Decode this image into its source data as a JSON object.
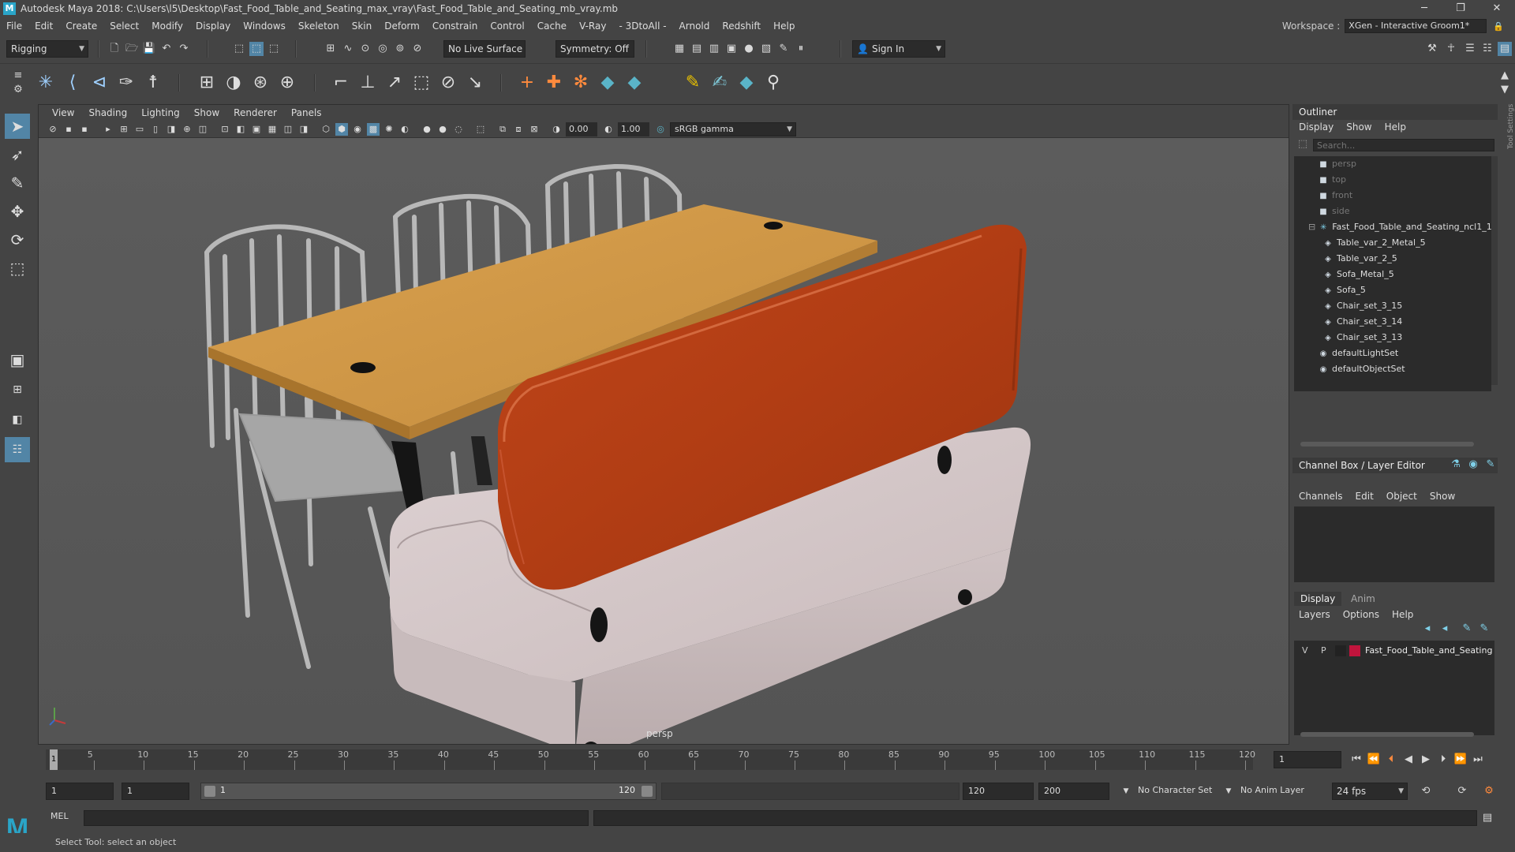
{
  "window": {
    "title": "Autodesk Maya 2018: C:\\Users\\l5\\Desktop\\Fast_Food_Table_and_Seating_max_vray\\Fast_Food_Table_and_Seating_mb_vray.mb",
    "logo": "M",
    "minimize": "─",
    "maximize": "❐",
    "close": "✕"
  },
  "menubar": {
    "items": [
      "File",
      "Edit",
      "Create",
      "Select",
      "Modify",
      "Display",
      "Windows",
      "Skeleton",
      "Skin",
      "Deform",
      "Constrain",
      "Control",
      "Cache",
      "V-Ray",
      "- 3DtoAll -",
      "Arnold",
      "Redshift",
      "Help"
    ],
    "workspace_label": "Workspace :",
    "workspace_value": "XGen - Interactive Groom1*"
  },
  "statusline": {
    "mode": "Rigging",
    "live_surface": "No Live Surface",
    "symmetry": "Symmetry: Off",
    "sign_in": "Sign In"
  },
  "viewport": {
    "menu": [
      "View",
      "Shading",
      "Lighting",
      "Show",
      "Renderer",
      "Panels"
    ],
    "exposure": "0.00",
    "gamma": "1.00",
    "colorspace": "sRGB gamma",
    "camera_label": "persp"
  },
  "outliner": {
    "title": "Outliner",
    "menu": [
      "Display",
      "Show",
      "Help"
    ],
    "search_placeholder": "Search...",
    "items": [
      {
        "label": "persp",
        "dim": true,
        "indent": 1,
        "icon": "camera"
      },
      {
        "label": "top",
        "dim": true,
        "indent": 1,
        "icon": "camera"
      },
      {
        "label": "front",
        "dim": true,
        "indent": 1,
        "icon": "camera"
      },
      {
        "label": "side",
        "dim": true,
        "indent": 1,
        "icon": "camera"
      },
      {
        "label": "Fast_Food_Table_and_Seating_ncl1_1",
        "dim": false,
        "indent": 0,
        "icon": "group"
      },
      {
        "label": "Table_var_2_Metal_5",
        "dim": false,
        "indent": 2,
        "icon": "transform"
      },
      {
        "label": "Table_var_2_5",
        "dim": false,
        "indent": 2,
        "icon": "transform"
      },
      {
        "label": "Sofa_Metal_5",
        "dim": false,
        "indent": 2,
        "icon": "transform"
      },
      {
        "label": "Sofa_5",
        "dim": false,
        "indent": 2,
        "icon": "transform"
      },
      {
        "label": "Chair_set_3_15",
        "dim": false,
        "indent": 2,
        "icon": "transform"
      },
      {
        "label": "Chair_set_3_14",
        "dim": false,
        "indent": 2,
        "icon": "transform"
      },
      {
        "label": "Chair_set_3_13",
        "dim": false,
        "indent": 2,
        "icon": "transform"
      },
      {
        "label": "defaultLightSet",
        "dim": false,
        "indent": 1,
        "icon": "set"
      },
      {
        "label": "defaultObjectSet",
        "dim": false,
        "indent": 1,
        "icon": "set"
      }
    ]
  },
  "channelbox": {
    "title": "Channel Box / Layer Editor",
    "menu": [
      "Channels",
      "Edit",
      "Object",
      "Show"
    ]
  },
  "layers": {
    "tabs": [
      "Display",
      "Anim"
    ],
    "menu": [
      "Layers",
      "Options",
      "Help"
    ],
    "row": {
      "v": "V",
      "p": "P",
      "name": "Fast_Food_Table_and_Seating",
      "color": "#c0143c"
    }
  },
  "timeslider": {
    "labels": [
      "5",
      "10",
      "15",
      "20",
      "25",
      "30",
      "35",
      "40",
      "45",
      "50",
      "55",
      "60",
      "65",
      "70",
      "75",
      "80",
      "85",
      "90",
      "95",
      "100",
      "105",
      "110",
      "115",
      "120"
    ],
    "current_marker": "1",
    "current_frame": "1"
  },
  "range": {
    "start": "1",
    "playback_start": "1",
    "slider_start": "1",
    "slider_end": "120",
    "playback_end": "120",
    "end": "200",
    "character_set": "No Character Set",
    "anim_layer": "No Anim Layer",
    "fps": "24 fps"
  },
  "cmdline": {
    "lang": "MEL"
  },
  "helpline": {
    "text": "Select Tool: select an object"
  },
  "sidebar_vertical": "Tool Settings"
}
